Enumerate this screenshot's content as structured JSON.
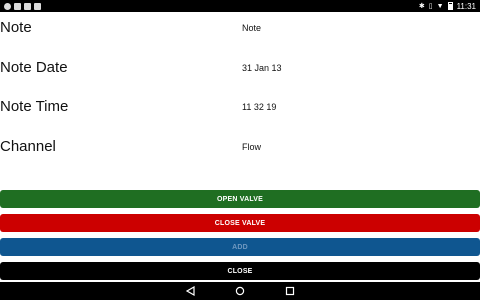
{
  "status_bar": {
    "time": "11:31",
    "notifications": [
      "settings-notification-icon",
      "image-notification-icon",
      "message-notification-icon",
      "gallery-notification-icon"
    ],
    "system_icons": [
      "bluetooth-icon",
      "vibrate-icon",
      "wifi-icon",
      "battery-icon"
    ]
  },
  "form": {
    "rows": [
      {
        "label": "Note",
        "value": "Note"
      },
      {
        "label": "Note Date",
        "value": "31 Jan 13"
      },
      {
        "label": "Note Time",
        "value": "11 32 19"
      },
      {
        "label": "Channel",
        "value": "Flow"
      }
    ]
  },
  "buttons": {
    "open_valve": "OPEN VALVE",
    "close_valve": "CLOSE VALVE",
    "add": "ADD",
    "close": "CLOSE"
  },
  "colors": {
    "open_valve": "#1f6e22",
    "close_valve": "#cc0000",
    "add": "#0f5690",
    "close": "#000000"
  },
  "nav_bar": {
    "icons": [
      "back-icon",
      "home-icon",
      "recents-icon"
    ]
  }
}
